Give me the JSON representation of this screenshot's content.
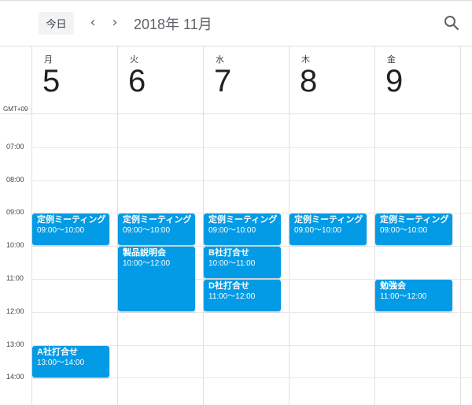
{
  "toolbar": {
    "today_label": "今日",
    "prev_glyph": "‹",
    "next_glyph": "›",
    "period_label": "2018年 11月",
    "search_icon": "search-icon"
  },
  "timezone_label": "GMT+09",
  "days": [
    {
      "name": "月",
      "number": "5"
    },
    {
      "name": "火",
      "number": "6"
    },
    {
      "name": "水",
      "number": "7"
    },
    {
      "name": "木",
      "number": "8"
    },
    {
      "name": "金",
      "number": "9"
    }
  ],
  "hours": [
    "07:00",
    "08:00",
    "09:00",
    "10:00",
    "11:00",
    "12:00",
    "13:00",
    "14:00"
  ],
  "events": [
    {
      "day": 0,
      "title": "定例ミーティング",
      "time": "09:00〜10:00",
      "start": 9,
      "end": 10
    },
    {
      "day": 1,
      "title": "定例ミーティング",
      "time": "09:00〜10:00",
      "start": 9,
      "end": 10
    },
    {
      "day": 2,
      "title": "定例ミーティング",
      "time": "09:00〜10:00",
      "start": 9,
      "end": 10
    },
    {
      "day": 3,
      "title": "定例ミーティング",
      "time": "09:00〜10:00",
      "start": 9,
      "end": 10
    },
    {
      "day": 4,
      "title": "定例ミーティング",
      "time": "09:00〜10:00",
      "start": 9,
      "end": 10
    },
    {
      "day": 1,
      "title": "製品説明会",
      "time": "10:00〜12:00",
      "start": 10,
      "end": 12
    },
    {
      "day": 2,
      "title": "B社打合せ",
      "time": "10:00〜11:00",
      "start": 10,
      "end": 11
    },
    {
      "day": 2,
      "title": "D社打合せ",
      "time": "11:00〜12:00",
      "start": 11,
      "end": 12
    },
    {
      "day": 4,
      "title": "勉強会",
      "time": "11:00〜12:00",
      "start": 11,
      "end": 12
    },
    {
      "day": 0,
      "title": "A社打合せ",
      "time": "13:00〜14:00",
      "start": 13,
      "end": 14
    }
  ],
  "colors": {
    "event": "#039be5"
  }
}
